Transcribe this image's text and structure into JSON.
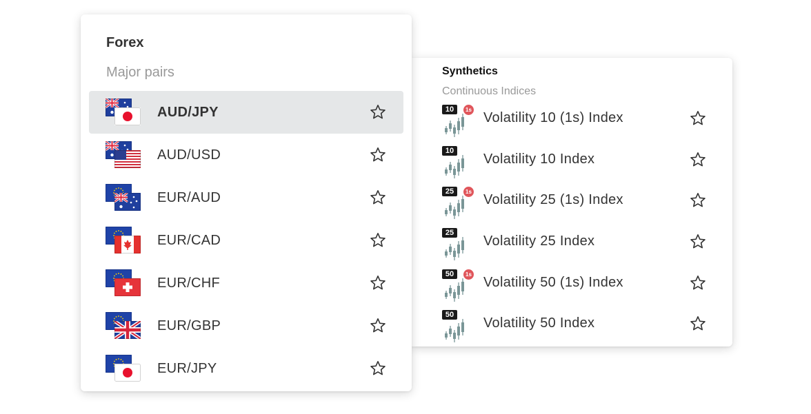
{
  "forex": {
    "title": "Forex",
    "subtitle": "Major pairs",
    "selected_index": 0,
    "items": [
      {
        "label": "AUD/JPY",
        "flags": [
          "au",
          "jp"
        ],
        "selected": true
      },
      {
        "label": "AUD/USD",
        "flags": [
          "au",
          "us"
        ],
        "selected": false
      },
      {
        "label": "EUR/AUD",
        "flags": [
          "eu",
          "au"
        ],
        "selected": false
      },
      {
        "label": "EUR/CAD",
        "flags": [
          "eu",
          "ca"
        ],
        "selected": false
      },
      {
        "label": "EUR/CHF",
        "flags": [
          "eu",
          "ch"
        ],
        "selected": false
      },
      {
        "label": "EUR/GBP",
        "flags": [
          "eu",
          "gb"
        ],
        "selected": false
      },
      {
        "label": "EUR/JPY",
        "flags": [
          "eu",
          "jp"
        ],
        "selected": false
      }
    ]
  },
  "synthetics": {
    "title": "Synthetics",
    "subtitle": "Continuous Indices",
    "items": [
      {
        "label": "Volatility 10 (1s) Index",
        "badge": "10",
        "sec_badge": "1s"
      },
      {
        "label": "Volatility 10 Index",
        "badge": "10",
        "sec_badge": ""
      },
      {
        "label": "Volatility 25 (1s) Index",
        "badge": "25",
        "sec_badge": "1s"
      },
      {
        "label": "Volatility 25 Index",
        "badge": "25",
        "sec_badge": ""
      },
      {
        "label": "Volatility 50 (1s) Index",
        "badge": "50",
        "sec_badge": "1s"
      },
      {
        "label": "Volatility 50 Index",
        "badge": "50",
        "sec_badge": ""
      }
    ]
  },
  "icons": {
    "favorite": "star-outline-icon",
    "synthetic": "candlestick-chart-icon"
  },
  "colors": {
    "selected_row": "#e5e7e8",
    "sec_badge": "#e0565b",
    "badge": "#1a1a1a",
    "candles": "#7a9697",
    "subtitle": "#999999"
  }
}
